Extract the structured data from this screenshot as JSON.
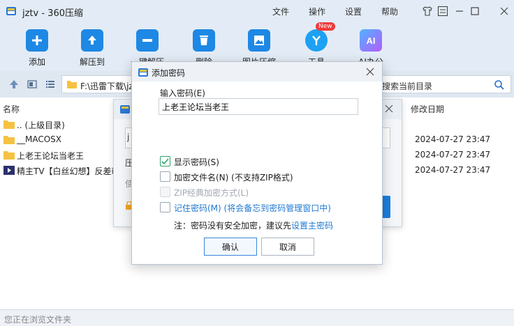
{
  "window": {
    "title": "jztv - 360压缩",
    "menu": [
      "文件",
      "操作",
      "设置",
      "帮助"
    ]
  },
  "toolbar": {
    "items": [
      {
        "label": "添加",
        "icon": "add-icon",
        "color": "#1e88e5"
      },
      {
        "label": "解压到",
        "icon": "extract-icon",
        "color": "#1e88e5"
      },
      {
        "label": "一键解压",
        "icon": "one-click-extract-icon",
        "color": "#1e88e5"
      },
      {
        "label": "删除",
        "icon": "delete-icon",
        "color": "#1e88e5"
      },
      {
        "label": "图片压缩",
        "icon": "image-compress-icon",
        "color": "#1e88e5"
      },
      {
        "label": "工具",
        "icon": "tools-icon",
        "color": "#1da1f2"
      },
      {
        "label": "AI办公",
        "icon": "ai-icon",
        "color": "#a355ff"
      }
    ],
    "new_badge": "New"
  },
  "address": {
    "path": "F:\\迅雷下载\\jztv",
    "search_placeholder": "搜索当前目录"
  },
  "file_list": {
    "columns": {
      "name": "名称",
      "date": "修改日期"
    },
    "rows": [
      {
        "name": ".. (上级目录)",
        "date": "",
        "type": "folder"
      },
      {
        "name": "__MACOSX",
        "date": "2024-07-27 23:47",
        "type": "folder"
      },
      {
        "name": "上老王论坛当老王",
        "date": "2024-07-27 23:47",
        "type": "folder"
      },
      {
        "name": "精主TV【白丝幻想】反差萌",
        "date": "2024-07-27 23:47",
        "type": "video"
      }
    ]
  },
  "status": {
    "text": "您正在浏览文件夹"
  },
  "bg_dialog": {
    "ghost_chars": [
      "j",
      "压",
      "使"
    ]
  },
  "password_dialog": {
    "title": "添加密码",
    "input_label": "输入密码(E)",
    "input_value": "上老王论坛当老王",
    "options": [
      {
        "label": "显示密码(S)",
        "checked": true,
        "disabled": false
      },
      {
        "label": "加密文件名(N) (不支持ZIP格式)",
        "checked": false,
        "disabled": false
      },
      {
        "label": "ZIP经典加密方式(L)",
        "checked": false,
        "disabled": true
      },
      {
        "label": "记住密码(M) (将会备忘到密码管理窗口中)",
        "checked": false,
        "disabled": false,
        "link": true
      }
    ],
    "note_prefix": "注：密码没有安全加密，建议先",
    "note_link": "设置主密码",
    "ok_label": "确认",
    "cancel_label": "取消"
  }
}
